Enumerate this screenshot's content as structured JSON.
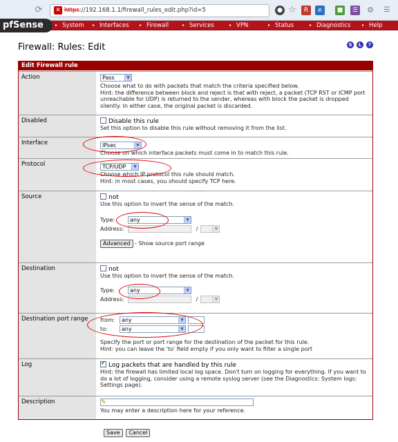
{
  "browser": {
    "url_scheme": "https",
    "url_rest": "://192.168.1.1/firewall_rules_edit.php?id=5"
  },
  "brand": {
    "logo": "Sense",
    "logo_prefix": "pf"
  },
  "menu": [
    "System",
    "Interfaces",
    "Firewall",
    "Services",
    "VPN",
    "Status",
    "Diagnostics",
    "Help"
  ],
  "page": {
    "title": "Firewall: Rules: Edit",
    "icons": [
      "status-icon",
      "log-icon",
      "help-icon"
    ]
  },
  "table_header": "Edit Firewall rule",
  "action": {
    "label": "Action",
    "value": "Pass",
    "hint1": "Choose what to do with packets that match the criteria specified below.",
    "hint2": "Hint: the difference between block and reject is that with reject, a packet (TCP RST or ICMP port unreachable for UDP) is returned to the sender, whereas with block the packet is dropped silently. In either case, the original packet is discarded."
  },
  "disabled": {
    "label": "Disabled",
    "checkbox_label": "Disable this rule",
    "hint": "Set this option to disable this rule without removing it from the list."
  },
  "interface": {
    "label": "Interface",
    "value": "IPsec",
    "hint": "Choose on which interface packets must come in to match this rule."
  },
  "protocol": {
    "label": "Protocol",
    "value": "TCP/UDP",
    "hint1": "Choose which IP protocol this rule should match.",
    "hint2": "Hint: in most cases, you should specify  TCP  here."
  },
  "source": {
    "label": "Source",
    "not_label": "not",
    "hint": "Use this option to invert the sense of the match.",
    "type_label": "Type:",
    "type_value": "any",
    "address_label": "Address:",
    "slash": "/",
    "advanced_button": "Advanced",
    "advanced_hint": " - Show source port range"
  },
  "destination": {
    "label": "Destination",
    "not_label": "not",
    "hint": "Use this option to invert the sense of the match.",
    "type_label": "Type:",
    "type_value": "any",
    "address_label": "Address:",
    "slash": "/"
  },
  "dest_port": {
    "label": "Destination port range",
    "from_label": "from:",
    "from_value": "any",
    "to_label": "to:",
    "to_value": "any",
    "hint1": "Specify the port or port range for the destination of the packet for this rule.",
    "hint2": "Hint: you can leave the  'to'  field empty if you only want to filter a single port"
  },
  "log": {
    "label": "Log",
    "checkbox_label": "Log packets that are handled by this rule",
    "hint": "Hint: the firewall has limited local log space. Don't turn on logging for everything. If you want to do a lot of logging, consider using a remote syslog server (see the Diagnostics: System logs: Settings page).",
    "checked": true
  },
  "description": {
    "label": "Description",
    "hint": "You may enter a description here for your reference."
  },
  "buttons": {
    "save": "Save",
    "cancel": "Cancel"
  },
  "colors": {
    "accent": "#990000",
    "menu": "#b3141c",
    "annotation": "#e00000"
  }
}
